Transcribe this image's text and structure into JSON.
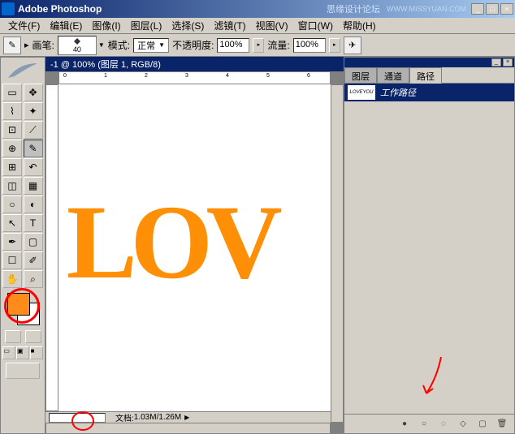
{
  "titlebar": {
    "app_name": "Adobe Photoshop",
    "forum": "思缘设计论坛",
    "watermark": "WWW.MISSYUAN.COM"
  },
  "menus": {
    "file": "文件(F)",
    "edit": "编辑(E)",
    "image": "图像(I)",
    "layer": "图层(L)",
    "select": "选择(S)",
    "filter": "滤镜(T)",
    "view": "视图(V)",
    "window": "窗口(W)",
    "help": "帮助(H)"
  },
  "toolbar": {
    "brush_label": "画笔:",
    "brush_size": "40",
    "mode_label": "模式:",
    "mode_value": "正常",
    "opacity_label": "不透明度:",
    "opacity_value": "100%",
    "flow_label": "流量:",
    "flow_value": "100%"
  },
  "document": {
    "title": "-1 @ 100% (图层 1, RGB/8)",
    "canvas_text": "LOV",
    "status_label": "文档:",
    "status_size": "1.03M/1.26M",
    "ruler_marks": [
      "0",
      "1",
      "2",
      "3",
      "4",
      "5",
      "6"
    ]
  },
  "panel": {
    "tabs": {
      "layers": "图层",
      "channels": "通道",
      "paths": "路径"
    },
    "path_name": "工作路径",
    "path_thumb_text": "LOVEYOU"
  },
  "tools": {
    "move": "✥",
    "marquee": "▭",
    "lasso": "⌇",
    "wand": "✦",
    "crop": "⊡",
    "slice": "⟋",
    "heal": "⊕",
    "brush": "✎",
    "stamp": "⊞",
    "history": "↶",
    "eraser": "◫",
    "gradient": "▦",
    "blur": "○",
    "dodge": "◐",
    "path": "↖",
    "type": "T",
    "pen": "✒",
    "shape": "▢",
    "notes": "☐",
    "eyedrop": "✐",
    "hand": "✋",
    "zoom": "⌕"
  },
  "colors": {
    "foreground": "#ff8c1a",
    "background": "#ffffff"
  }
}
